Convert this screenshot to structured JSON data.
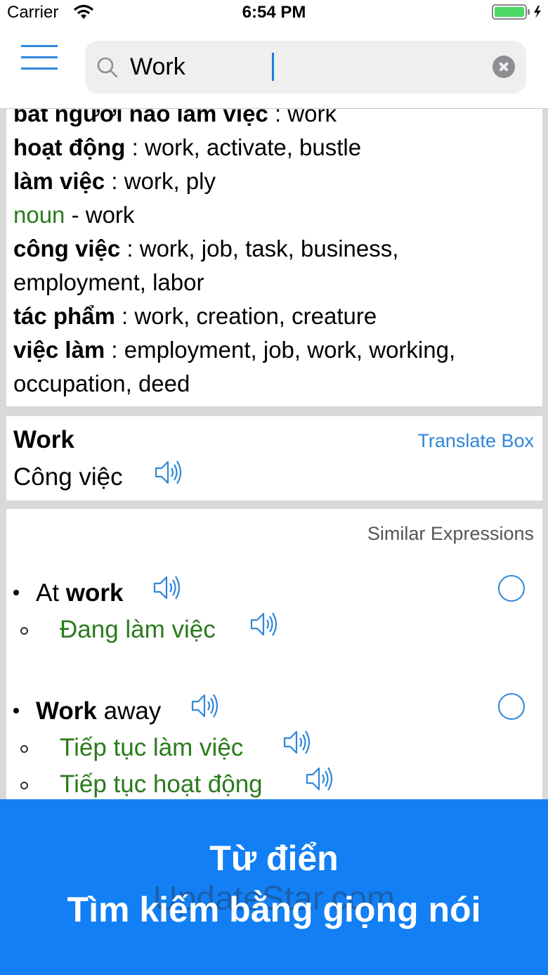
{
  "status_bar": {
    "carrier": "Carrier",
    "time": "6:54 PM"
  },
  "search": {
    "value": "Work",
    "placeholder": ""
  },
  "definitions": {
    "first_line": {
      "term": "bắt người nào làm việc",
      "sep": " : ",
      "meaning": "work"
    },
    "verb_lines": [
      {
        "term": "hoạt động",
        "sep": " : ",
        "meaning": "work, activate, bustle"
      },
      {
        "term": "làm việc",
        "sep": " : ",
        "meaning": "work, ply"
      }
    ],
    "noun_heading": {
      "pos": "noun",
      "rest": " - work"
    },
    "noun_lines": [
      {
        "term": "công việc",
        "sep": " : ",
        "meaning": "work, job, task, business, employment, labor"
      },
      {
        "term": "tác phẩm",
        "sep": " : ",
        "meaning": "work, creation, creature"
      },
      {
        "term": "việc làm",
        "sep": " : ",
        "meaning": "employment, job, work, working, occupation, deed"
      }
    ]
  },
  "translate": {
    "word": "Work",
    "link": "Translate Box",
    "meaning": "Công việc"
  },
  "similar": {
    "title": "Similar Expressions",
    "items": [
      {
        "part1": "At ",
        "part2_bold": "work",
        "subs": [
          "Đang làm việc"
        ]
      },
      {
        "part1_bold": "Work",
        "part2": " away",
        "subs": [
          "Tiếp tục làm việc",
          "Tiếp tục hoạt động"
        ]
      }
    ]
  },
  "banner": {
    "line1": "Từ điển",
    "line2": "Tìm kiếm bằng giọng nói",
    "watermark": "UpdateStar.com"
  },
  "colors": {
    "accent": "#2f86d9",
    "green": "#2a7a1c",
    "banner": "#127ff5"
  }
}
